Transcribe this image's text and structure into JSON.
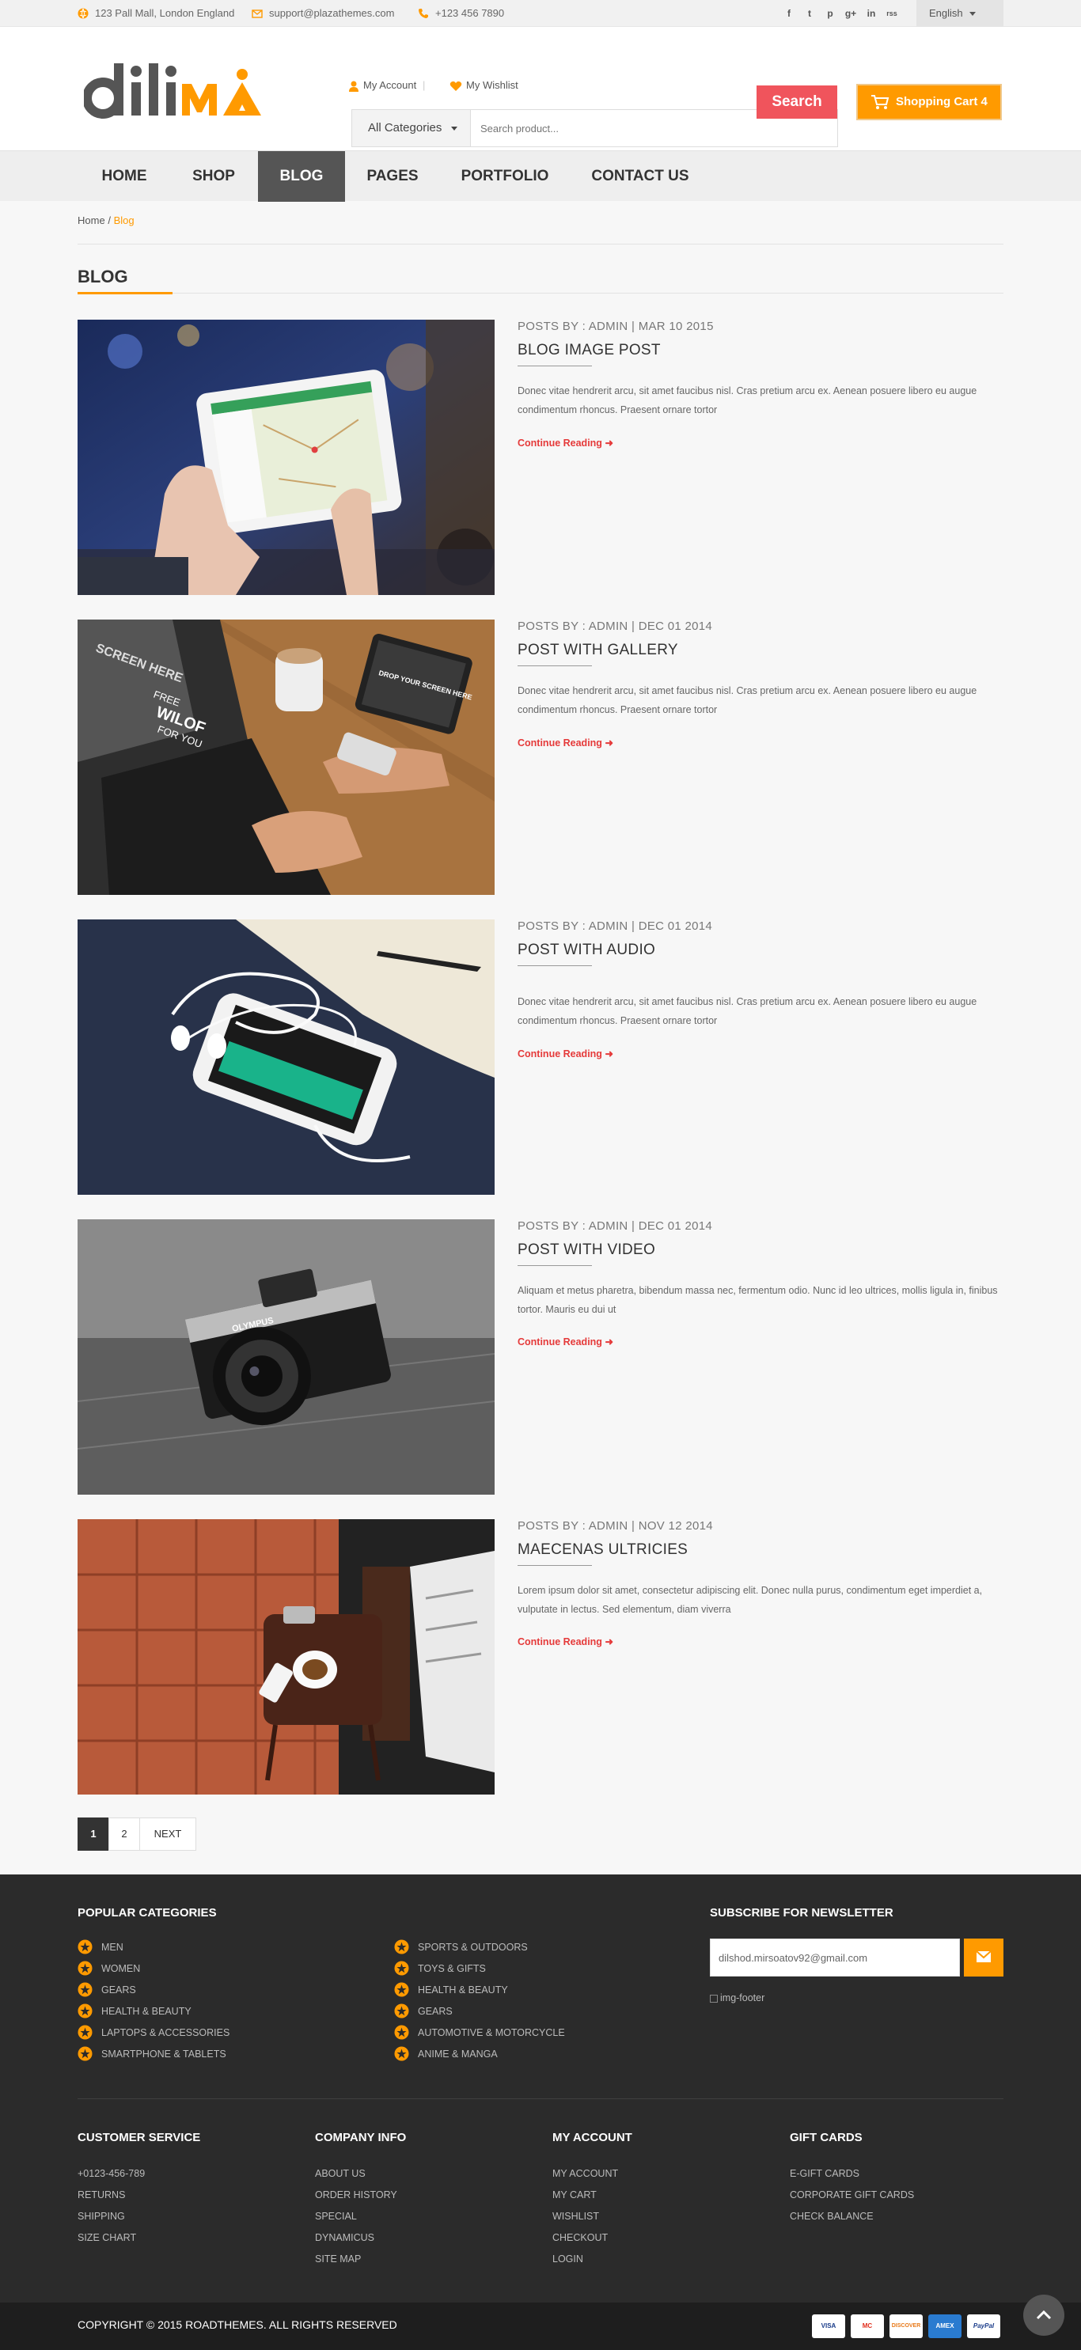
{
  "topbar": {
    "address": "123 Pall Mall, London England",
    "email": "support@plazathemes.com",
    "phone": "+123 456 7890",
    "social": [
      "f",
      "t",
      "p",
      "g+",
      "in",
      "rss"
    ],
    "language": "English"
  },
  "header": {
    "logo_text": "dilima",
    "my_account": "My Account",
    "my_wishlist": "My Wishlist",
    "search_category": "All Categories",
    "search_placeholder": "Search product...",
    "search_button": "Search",
    "cart_label": "Shopping Cart 4"
  },
  "nav": {
    "items": [
      "HOME",
      "SHOP",
      "BLOG",
      "PAGES",
      "PORTFOLIO",
      "CONTACT US"
    ],
    "active": "BLOG"
  },
  "breadcrumb": {
    "home": "Home",
    "separator": "/",
    "current": "Blog"
  },
  "page_title": "BLOG",
  "posts": [
    {
      "meta": "POSTS BY :   ADMIN | MAR 10 2015",
      "title": "BLOG IMAGE POST",
      "excerpt": "Donec vitae hendrerit arcu, sit amet faucibus nisl. Cras pretium arcu ex. Aenean posuere libero eu augue condimentum rhoncus. Praesent ornare tortor",
      "more": "Continue Reading",
      "image": "tablet-map"
    },
    {
      "meta": "POSTS BY :   ADMIN | DEC 01 2014",
      "title": "POST WITH GALLERY",
      "excerpt": "Donec vitae hendrerit arcu, sit amet faucibus nisl. Cras pretium arcu ex. Aenean posuere libero eu augue condimentum rhoncus. Praesent ornare tortor",
      "more": "Continue Reading",
      "image": "laptop-desk",
      "image_text": [
        "SCREEN HERE",
        "FREE",
        "WILOF",
        "FOR YOU",
        "DROP YOUR SCREEN HERE"
      ]
    },
    {
      "meta": "POSTS BY :   ADMIN | DEC 01 2014",
      "title": "POST WITH AUDIO",
      "excerpt": "Donec vitae hendrerit arcu, sit amet faucibus nisl. Cras pretium arcu ex. Aenean posuere libero eu augue condimentum rhoncus. Praesent ornare tortor",
      "more": "Continue Reading",
      "image": "phone-earbuds"
    },
    {
      "meta": "POSTS BY :   ADMIN | DEC 01 2014",
      "title": "POST WITH VIDEO",
      "excerpt": "Aliquam et metus pharetra, bibendum massa nec, fermentum odio. Nunc id leo ultrices, mollis ligula in, finibus tortor. Mauris eu dui ut",
      "more": "Continue Reading",
      "image": "camera",
      "image_text": [
        "OLYMPUS"
      ]
    },
    {
      "meta": "POSTS BY :   ADMIN | NOV 12 2014",
      "title": "MAECENAS ULTRICIES",
      "excerpt": "Lorem ipsum dolor sit amet, consectetur adipiscing elit. Donec nulla purus, condimentum eget imperdiet a, vulputate in lectus. Sed elementum, diam viverra",
      "more": "Continue Reading",
      "image": "coffee-tiles"
    }
  ],
  "pagination": {
    "pages": [
      "1",
      "2"
    ],
    "next": "NEXT",
    "current": "1"
  },
  "footer": {
    "popular_title": "POPULAR CATEGORIES",
    "popular_left": [
      "MEN",
      "WOMEN",
      "GEARS",
      "HEALTH & BEAUTY",
      "LAPTOPS & ACCESSORIES",
      "SMARTPHONE & TABLETS"
    ],
    "popular_right": [
      "SPORTS & OUTDOORS",
      "TOYS & GIFTS",
      "HEALTH & BEAUTY",
      "GEARS",
      "AUTOMOTIVE & MOTORCYCLE",
      "ANIME & MANGA"
    ],
    "newsletter_title": "SUBSCRIBE FOR NEWSLETTER",
    "newsletter_value": "dilshod.mirsoatov92@gmail.com",
    "footer_img_alt": "img-footer",
    "columns": [
      {
        "title": "CUSTOMER SERVICE",
        "links": [
          "+0123-456-789",
          "RETURNS",
          "SHIPPING",
          "SIZE CHART"
        ]
      },
      {
        "title": "COMPANY INFO",
        "links": [
          "ABOUT US",
          "ORDER HISTORY",
          "SPECIAL",
          "DYNAMICUS",
          "SITE MAP"
        ]
      },
      {
        "title": "MY ACCOUNT",
        "links": [
          "MY ACCOUNT",
          "MY CART",
          "WISHLIST",
          "CHECKOUT",
          "LOGIN"
        ]
      },
      {
        "title": "GIFT CARDS",
        "links": [
          "E-GIFT CARDS",
          "CORPORATE GIFT CARDS",
          "CHECK BALANCE"
        ]
      }
    ],
    "copyright": "COPYRIGHT © 2015 ROADTHEMES. ALL RIGHTS RESERVED",
    "payments": [
      "VISA",
      "MC",
      "DISCOVER",
      "AMEX",
      "PayPal"
    ]
  },
  "colors": {
    "accent": "#ff9a00",
    "search": "#f0545c",
    "link_red": "#e53a3a",
    "footer_bg": "#2b2b2b",
    "nav_active": "#555555"
  }
}
